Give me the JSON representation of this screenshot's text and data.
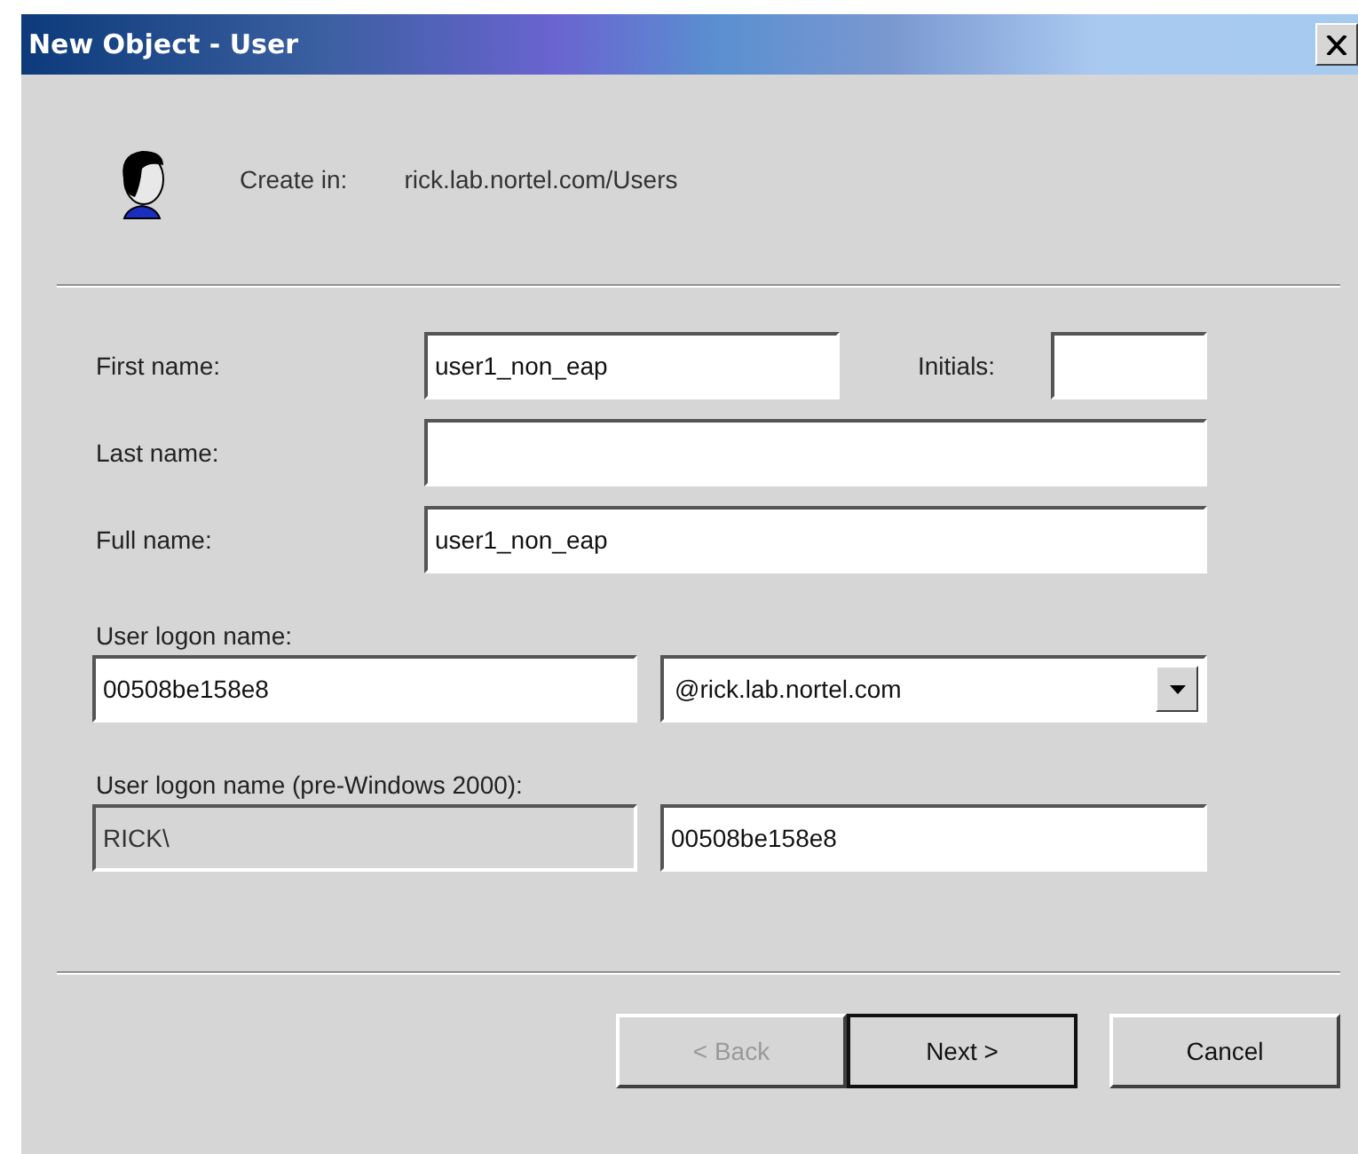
{
  "window": {
    "title": "New Object - User"
  },
  "header": {
    "label": "Create in:",
    "path": "rick.lab.nortel.com/Users"
  },
  "name_fields": [
    {
      "label": "First name:",
      "value": "user1_non_eap",
      "initials": {
        "label": "Initials:"
      }
    },
    {
      "label": "Last name:"
    },
    {
      "label": "Full name:",
      "value": "user1_non_eap"
    }
  ],
  "logon": {
    "label": "User logon name:",
    "value": "00508be158e8",
    "domain": "@rick.lab.nortel.com"
  },
  "pre2000": {
    "label": "User logon name (pre-Windows 2000):",
    "domain": {
      "value": "RICK\\",
      "disabled": true
    },
    "value": "00508be158e8"
  },
  "buttons": [
    {
      "label": "< Back",
      "disabled": true,
      "default": false
    },
    {
      "label": "Next >",
      "disabled": false,
      "default": true
    },
    {
      "label": "Cancel",
      "disabled": false,
      "default": false
    }
  ]
}
